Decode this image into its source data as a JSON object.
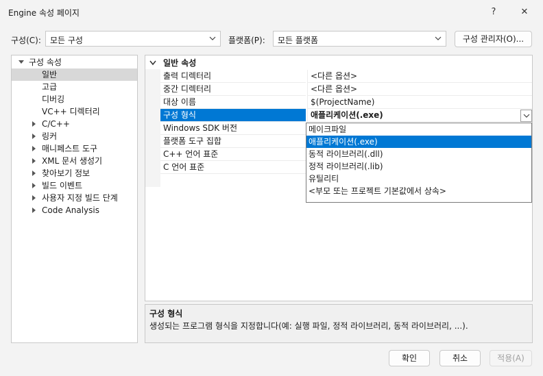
{
  "window": {
    "title": "Engine 속성 페이지",
    "help": "?",
    "close": "✕"
  },
  "config": {
    "label": "구성(C):",
    "value": "모든 구성",
    "platform_label": "플랫폼(P):",
    "platform_value": "모든 플랫폼",
    "manager_button": "구성 관리자(O)..."
  },
  "tree": {
    "root": "구성 속성",
    "items": [
      "일반",
      "고급",
      "디버깅",
      "VC++ 디렉터리"
    ],
    "groups": [
      "C/C++",
      "링커",
      "매니페스트 도구",
      "XML 문서 생성기",
      "찾아보기 정보",
      "빌드 이벤트",
      "사용자 지정 빌드 단계",
      "Code Analysis"
    ]
  },
  "grid": {
    "category": "일반 속성",
    "rows": [
      {
        "name": "출력 디렉터리",
        "value": "<다른 옵션>"
      },
      {
        "name": "중간 디렉터리",
        "value": "<다른 옵션>"
      },
      {
        "name": "대상 이름",
        "value": "$(ProjectName)"
      },
      {
        "name": "구성 형식",
        "value": "애플리케이션(.exe)"
      },
      {
        "name": "Windows SDK 버전",
        "value": ""
      },
      {
        "name": "플랫폼 도구 집합",
        "value": ""
      },
      {
        "name": "C++ 언어 표준",
        "value": ""
      },
      {
        "name": "C 언어 표준",
        "value": ""
      }
    ]
  },
  "dropdown": {
    "options": [
      "메이크파일",
      "애플리케이션(.exe)",
      "동적 라이브러리(.dll)",
      "정적 라이브러리(.lib)",
      "유틸리티",
      "<부모 또는 프로젝트 기본값에서 상속>"
    ]
  },
  "description": {
    "title": "구성 형식",
    "text": "생성되는 프로그램 형식을 지정합니다(예: 실행 파일, 정적 라이브러리, 동적 라이브러리, ...)."
  },
  "buttons": {
    "ok": "확인",
    "cancel": "취소",
    "apply": "적용(A)"
  }
}
